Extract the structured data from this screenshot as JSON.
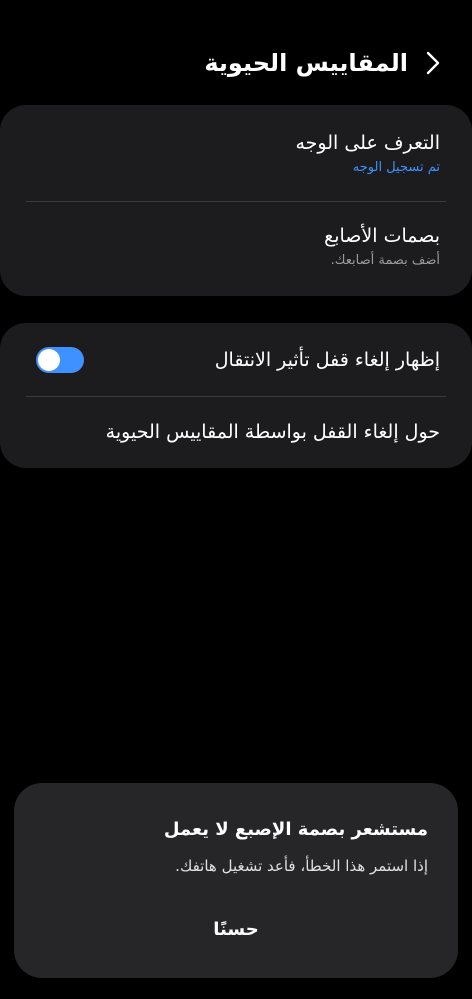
{
  "header": {
    "title": "المقاييس الحيوية",
    "back_icon": "chevron-left-icon"
  },
  "biometrics": {
    "face": {
      "title": "التعرف على الوجه",
      "status": "تم تسجيل الوجه"
    },
    "fingerprints": {
      "title": "بصمات الأصابع",
      "status": "أضف بصمة أصابعك."
    }
  },
  "settings": {
    "transition": {
      "label": "إظهار إلغاء قفل تأثير الانتقال",
      "enabled": true
    },
    "about": {
      "label": "حول إلغاء القفل بواسطة المقاييس الحيوية"
    }
  },
  "dialog": {
    "title": "مستشعر بصمة الإصبع لا يعمل",
    "message": "إذا استمر هذا الخطأ، فأعد تشغيل هاتفك.",
    "ok_label": "حسنًا"
  },
  "colors": {
    "accent": "#3e91ff",
    "card": "#1c1c1e",
    "dialog": "#262628",
    "background": "#000000"
  }
}
